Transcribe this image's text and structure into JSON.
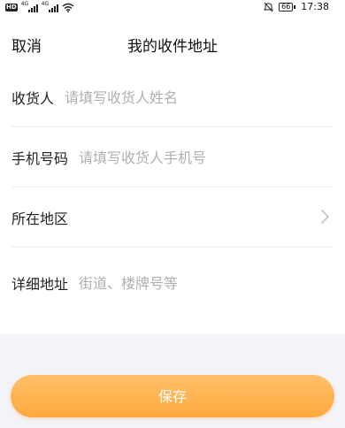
{
  "status_bar": {
    "hd": "HD",
    "signal1_label": "4G",
    "signal2_label": "4G",
    "battery": "66",
    "time": "17:38",
    "icons": [
      "signal-icon",
      "wifi-icon",
      "mute-icon",
      "battery-icon"
    ]
  },
  "header": {
    "cancel_label": "取消",
    "title": "我的收件地址"
  },
  "form": {
    "recipient": {
      "label": "收货人",
      "placeholder": "请填写收货人姓名",
      "value": ""
    },
    "phone": {
      "label": "手机号码",
      "placeholder": "请填写收货人手机号",
      "value": ""
    },
    "region": {
      "label": "所在地区",
      "value": ""
    },
    "address": {
      "label": "详细地址",
      "placeholder": "街道、楼牌号等",
      "value": ""
    }
  },
  "actions": {
    "save_label": "保存"
  },
  "colors": {
    "accent_top": "#ffc06a",
    "accent_bottom": "#ffa93e",
    "placeholder": "#b0b0b0",
    "background_gray": "#f3f4f8"
  }
}
